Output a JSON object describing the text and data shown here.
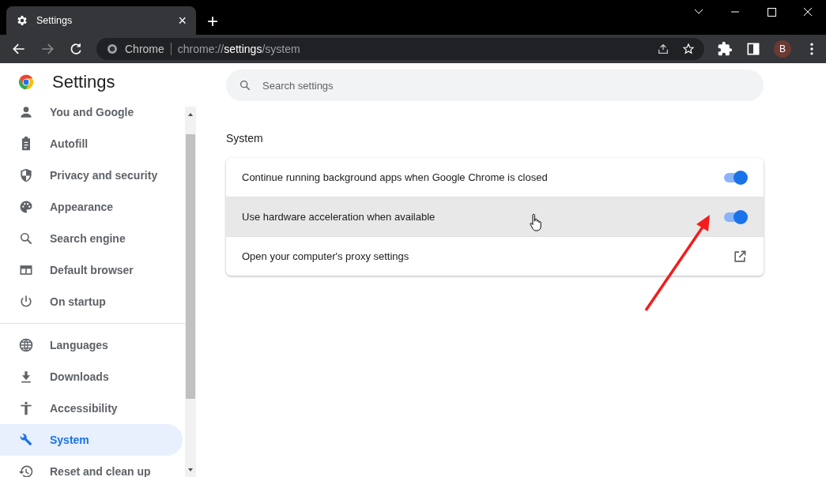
{
  "tab": {
    "title": "Settings",
    "close": "×",
    "new_tab": "+"
  },
  "toolbar": {
    "site_label": "Chrome",
    "url": "chrome://**settings**/system",
    "profile": "B"
  },
  "sidebar": {
    "title": "Settings",
    "groups": [
      [
        {
          "label": "You and Google",
          "selected": false
        },
        {
          "label": "Autofill",
          "selected": false
        },
        {
          "label": "Privacy and security",
          "selected": false
        },
        {
          "label": "Appearance",
          "selected": false
        },
        {
          "label": "Search engine",
          "selected": false
        },
        {
          "label": "Default browser",
          "selected": false
        },
        {
          "label": "On startup",
          "selected": false
        }
      ],
      [
        {
          "label": "Languages",
          "selected": false
        },
        {
          "label": "Downloads",
          "selected": false
        },
        {
          "label": "Accessibility",
          "selected": false
        },
        {
          "label": "System",
          "selected": true
        },
        {
          "label": "Reset and clean up",
          "selected": false
        }
      ]
    ]
  },
  "search": {
    "placeholder": "Search settings"
  },
  "section": {
    "title": "System",
    "rows": [
      {
        "kind": "toggle",
        "label": "Continue running background apps when Google Chrome is closed",
        "on": true,
        "hovered": false
      },
      {
        "kind": "toggle",
        "label": "Use hardware acceleration when available",
        "on": true,
        "hovered": true
      },
      {
        "kind": "link",
        "label": "Open your computer's proxy settings",
        "hovered": false
      }
    ]
  }
}
